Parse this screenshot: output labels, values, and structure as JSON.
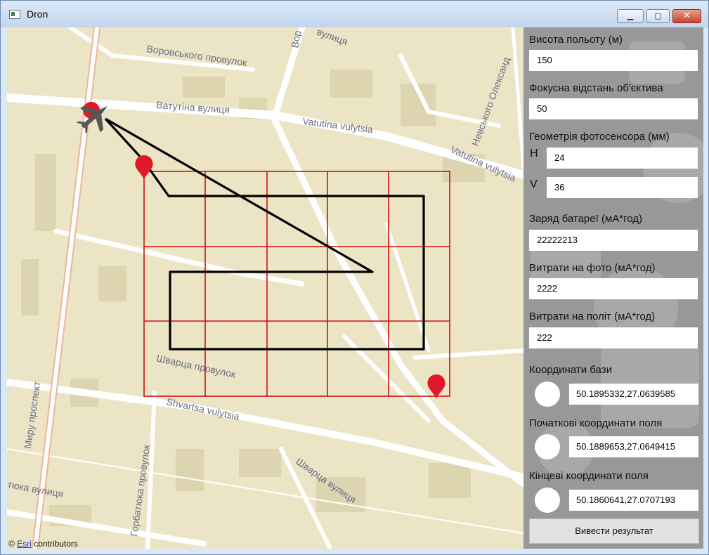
{
  "window": {
    "title": "Dron",
    "minimize_glyph": "▁",
    "maximize_glyph": "▢",
    "close_glyph": "✕"
  },
  "map": {
    "attribution_prefix": "© ",
    "attribution_link": "Esri",
    "attribution_suffix": " contributors",
    "streets": {
      "vorovskoho": "Воровського провулок",
      "vatutina": "Ватутіна   вулиця",
      "vatutina_lat": "Vatutina   vulytsia",
      "vatutina_lat2": "Vatutina  vulytsia",
      "vulytsia_top": "вулиця",
      "vor": "Вор",
      "nevskoho": "Невського Олександ",
      "svartsa": "Шварца провулок",
      "shvartsa_lat": "Shvartsa vulytsia",
      "svartsa_vul": "Шварца вулиця",
      "myru": "Миру  проспект",
      "horbatiuka": "Горбатюка провулок",
      "tiuka": "тюка вулиця"
    },
    "colors": {
      "base": "#ebe4c5",
      "road": "#ffffff",
      "grid": "#cc1111",
      "path": "#000000",
      "marker": "#e0192a",
      "plane": "#555555"
    },
    "icons": [
      "airplane-icon",
      "map-marker-icon"
    ]
  },
  "panel": {
    "altitude_label": "Висота польоту (м)",
    "altitude_value": "150",
    "focal_label": "Фокусна відстань об'єктива",
    "focal_value": "50",
    "sensor_label": "Геометрія фотосенсора (мм)",
    "sensor_h_label": "H",
    "sensor_h_value": "24",
    "sensor_v_label": "V",
    "sensor_v_value": "36",
    "battery_label": "Заряд батареї (мА*год)",
    "battery_value": "22222213",
    "photo_cost_label": "Витрати на фото (мА*год)",
    "photo_cost_value": "2222",
    "flight_cost_label": "Витрати на політ (мА*год)",
    "flight_cost_value": "222",
    "base_coords_label": "Координати бази",
    "base_coords_value": "50.1895332,27.0639585",
    "start_coords_label": "Початкові координати поля",
    "start_coords_value": "50.1889653,27.0649415",
    "end_coords_label": "Кінцеві координати поля",
    "end_coords_value": "50.1860641,27.0707193",
    "result_button": "Вивести результат"
  }
}
